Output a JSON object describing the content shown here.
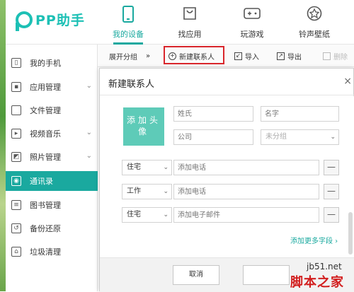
{
  "app": {
    "logo_text": "PP助手",
    "brand_color": "#1aa99f"
  },
  "nav_tabs": [
    {
      "label": "我的设备",
      "icon": "phone-icon",
      "active": true
    },
    {
      "label": "找应用",
      "icon": "bag-icon",
      "active": false
    },
    {
      "label": "玩游戏",
      "icon": "gamepad-icon",
      "active": false
    },
    {
      "label": "铃声壁纸",
      "icon": "music-icon",
      "active": false
    }
  ],
  "sidebar": {
    "items": [
      {
        "label": "我的手机",
        "icon": "phone-icon",
        "expandable": false
      },
      {
        "label": "应用管理",
        "icon": "apps-icon",
        "expandable": true
      },
      {
        "label": "文件管理",
        "icon": "folder-icon",
        "expandable": false
      },
      {
        "label": "视频音乐",
        "icon": "video-icon",
        "expandable": true
      },
      {
        "label": "照片管理",
        "icon": "photo-icon",
        "expandable": true
      },
      {
        "label": "通讯录",
        "icon": "contacts-icon",
        "expandable": false,
        "active": true
      },
      {
        "label": "图书管理",
        "icon": "book-icon",
        "expandable": false
      },
      {
        "label": "备份还原",
        "icon": "backup-icon",
        "expandable": false
      },
      {
        "label": "垃圾清理",
        "icon": "trash-icon",
        "expandable": false
      }
    ],
    "chevron": "⌄"
  },
  "toolbar": {
    "expand_label": "展开分组",
    "expand_arrow": "»",
    "new_contact_label": "新建联系人",
    "import_label": "导入",
    "export_label": "导出",
    "delete_label": "删除"
  },
  "dialog": {
    "title": "新建联系人",
    "close": "×",
    "avatar_label": "添加头像",
    "last_name_placeholder": "姓氏",
    "first_name_placeholder": "名字",
    "company_placeholder": "公司",
    "group_value": "未分组",
    "rows": [
      {
        "type": "住宅",
        "placeholder": "添加电话"
      },
      {
        "type": "工作",
        "placeholder": "添加电话"
      },
      {
        "type": "住宅",
        "placeholder": "添加电子邮件"
      }
    ],
    "remove_symbol": "—",
    "more_fields_label": "添加更多字段  ›",
    "cancel_label": "取消"
  },
  "watermark": {
    "url": "jb51.net",
    "name": "脚本之家"
  }
}
